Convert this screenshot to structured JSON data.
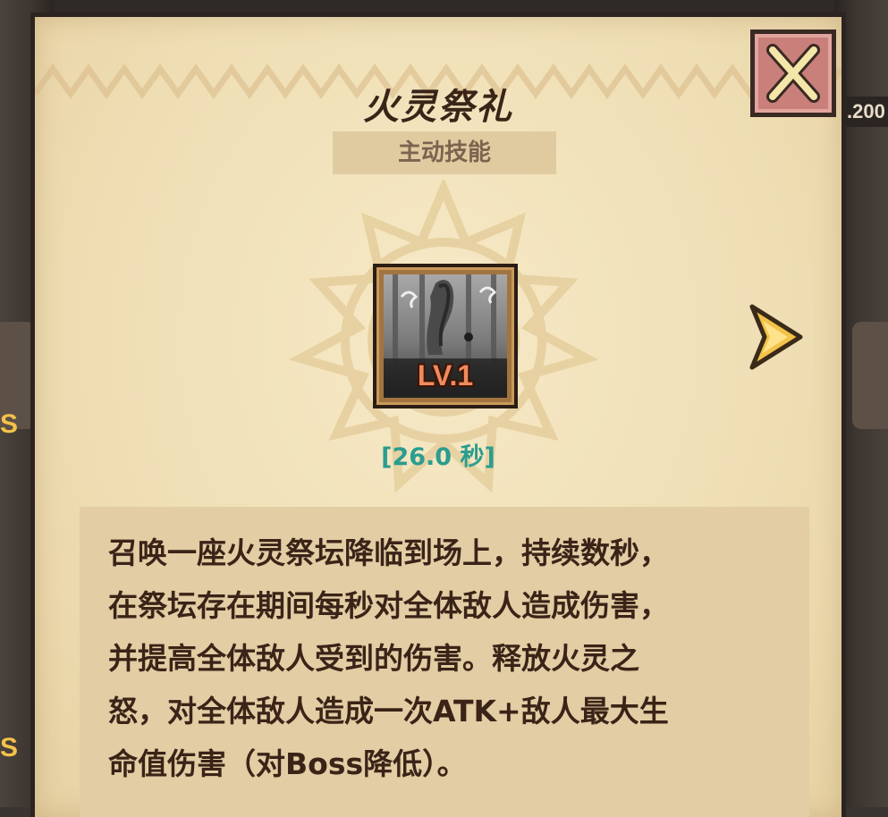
{
  "skill": {
    "name": "火灵祭礼",
    "type": "主动技能",
    "level": "LV.1",
    "cooldown": "[26.0 秒]",
    "description": "召唤一座火灵祭坛降临到场上，持续数秒，\n在祭坛存在期间每秒对全体敌人造成伤害，\n并提高全体敌人受到的伤害。释放火灵之\n怒，对全体敌人造成一次ATK+敌人最大生\n命值伤害（对Boss降低）。"
  },
  "background": {
    "left_labels": [
      "S",
      "S"
    ],
    "right_badge": ".200"
  },
  "colors": {
    "parchment": "#f2e3bd",
    "title": "#3a2418",
    "cooldown": "#2a9d8f",
    "level_text": "#f08a5d",
    "close_button": "#c97f7a",
    "arrow": "#f3c24a"
  },
  "icons": {
    "close": "close-icon",
    "next": "chevron-right-icon",
    "skill": "fire-spirit-altar-icon"
  }
}
